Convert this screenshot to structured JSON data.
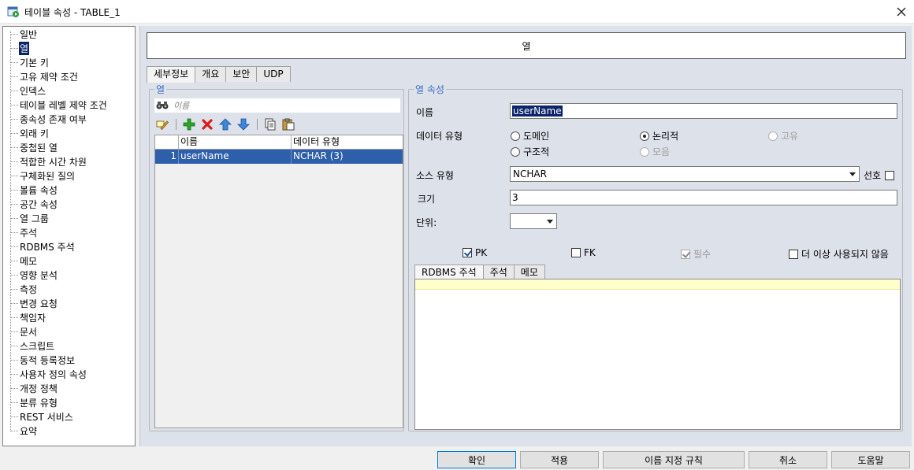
{
  "window": {
    "title": "테이블 속성 - TABLE_1"
  },
  "nav": {
    "items": [
      {
        "label": "일반"
      },
      {
        "label": "열",
        "selected": true
      },
      {
        "label": "기본 키"
      },
      {
        "label": "고유 제약 조건"
      },
      {
        "label": "인덱스"
      },
      {
        "label": "테이블 레벨 제약 조건"
      },
      {
        "label": "종속성 존재 여부"
      },
      {
        "label": "외래 키"
      },
      {
        "label": "중첩된 열"
      },
      {
        "label": "적합한 시간 차원"
      },
      {
        "label": "구체화된 질의"
      },
      {
        "label": "볼륨 속성"
      },
      {
        "label": "공간 속성"
      },
      {
        "label": "열 그룹"
      },
      {
        "label": "주석"
      },
      {
        "label": "RDBMS 주석"
      },
      {
        "label": "메모"
      },
      {
        "label": "영향 분석"
      },
      {
        "label": "측정"
      },
      {
        "label": "변경 요청"
      },
      {
        "label": "책임자"
      },
      {
        "label": "문서"
      },
      {
        "label": "스크립트"
      },
      {
        "label": "동적 등록정보"
      },
      {
        "label": "사용자 정의 속성"
      },
      {
        "label": "개정 정책"
      },
      {
        "label": "분류 유형"
      },
      {
        "label": "REST 서비스"
      },
      {
        "label": "요약"
      }
    ]
  },
  "header": {
    "title": "열"
  },
  "tabs": [
    {
      "label": "세부정보",
      "active": true
    },
    {
      "label": "개요"
    },
    {
      "label": "보안"
    },
    {
      "label": "UDP"
    }
  ],
  "columns_panel": {
    "legend": "열",
    "filter_placeholder": "이름",
    "grid": {
      "headers": [
        "",
        "이름",
        "데이터 유형"
      ],
      "rows": [
        {
          "num": "1",
          "name": "userName",
          "type": "NCHAR (3)"
        }
      ]
    }
  },
  "props": {
    "legend": "열 속성",
    "name_label": "이름",
    "name_value": "userName",
    "datatype_label": "데이터 유형",
    "radios": {
      "domain": "도메인",
      "logical": "논리적",
      "unique": "고유",
      "structured": "구조적",
      "collection": "모음"
    },
    "source_label": "소스 유형",
    "source_value": "NCHAR",
    "preferred_label": "선호",
    "size_label": "크기",
    "size_value": "3",
    "units_label": "단위:",
    "units_value": "",
    "checks": {
      "pk": "PK",
      "fk": "FK",
      "required": "필수",
      "deprecated": "더 이상 사용되지 않음"
    },
    "subtabs": [
      "RDBMS 주석",
      "주석",
      "메모"
    ]
  },
  "footer": {
    "ok": "확인",
    "apply": "적용",
    "naming": "이름 지정 규칙",
    "cancel": "취소",
    "help": "도움말"
  },
  "colors": {
    "selection": "#0a246a",
    "grid_selection": "#2d5faa",
    "legend": "#3a6bc4",
    "panel_bg": "#dde1e9"
  }
}
